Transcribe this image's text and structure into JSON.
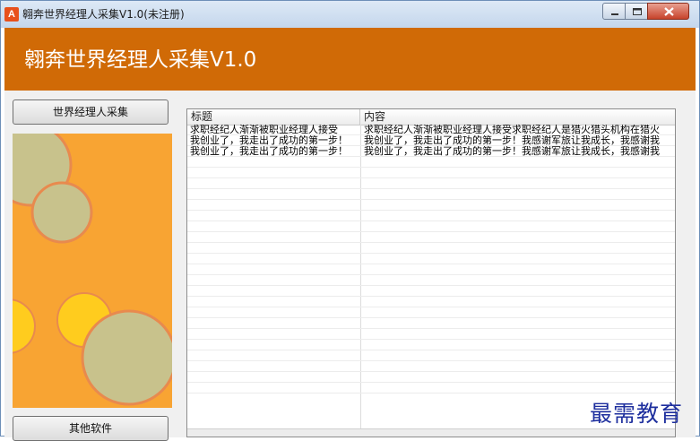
{
  "window": {
    "title": "翱奔世界经理人采集V1.0(未注册)",
    "app_icon_text": "A"
  },
  "banner": {
    "title": "翱奔世界经理人采集V1.0",
    "color": "#d06a06"
  },
  "sidebar": {
    "collect_button": "世界经理人采集",
    "other_button": "其他软件"
  },
  "grid": {
    "columns": [
      "标题",
      "内容"
    ],
    "rows": [
      {
        "title": "求职经纪人渐渐被职业经理人接受",
        "content": "求职经纪人渐渐被职业经理人接受求职经纪人是猎火猎头机构在猎火"
      },
      {
        "title": "我创业了，我走出了成功的第一步！",
        "content": "我创业了，我走出了成功的第一步！我感谢军旅让我成长，我感谢我"
      },
      {
        "title": "我创业了，我走出了成功的第一步！",
        "content": "我创业了，我走出了成功的第一步！我感谢军旅让我成长，我感谢我"
      }
    ]
  },
  "watermark": "最需教育"
}
